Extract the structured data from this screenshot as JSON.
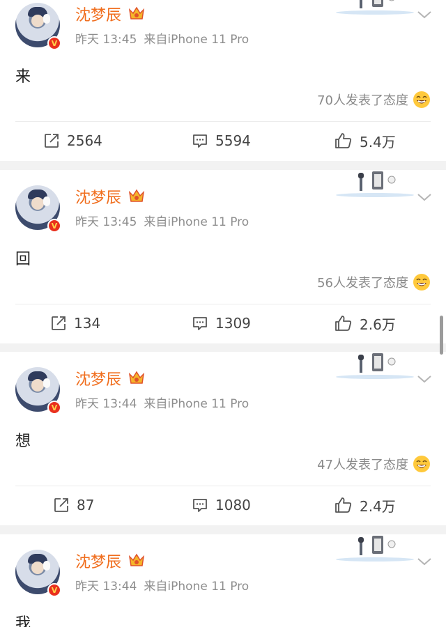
{
  "posts": [
    {
      "username": "沈梦辰",
      "time": "昨天 13:45",
      "source": "来自iPhone 11 Pro",
      "content": "来",
      "reactions": "70人发表了态度",
      "reposts": "2564",
      "comments": "5594",
      "likes": "5.4万"
    },
    {
      "username": "沈梦辰",
      "time": "昨天 13:45",
      "source": "来自iPhone 11 Pro",
      "content": "回",
      "reactions": "56人发表了态度",
      "reposts": "134",
      "comments": "1309",
      "likes": "2.6万"
    },
    {
      "username": "沈梦辰",
      "time": "昨天 13:44",
      "source": "来自iPhone 11 Pro",
      "content": "想",
      "reactions": "47人发表了态度",
      "reposts": "87",
      "comments": "1080",
      "likes": "2.4万"
    },
    {
      "username": "沈梦辰",
      "time": "昨天 13:44",
      "source": "来自iPhone 11 Pro",
      "content": "我"
    }
  ],
  "icons": {
    "verified": "v-badge-icon",
    "vip": "crown-icon",
    "more": "chevron-down-icon",
    "repost": "repost-icon",
    "comment": "comment-icon",
    "like": "thumb-up-icon",
    "reaction": "laughing-emoji-icon"
  },
  "colors": {
    "username": "#f06e1e",
    "meta": "#8e8e8e",
    "verified_badge": "#e9301e",
    "separator": "#f2f2f2"
  }
}
